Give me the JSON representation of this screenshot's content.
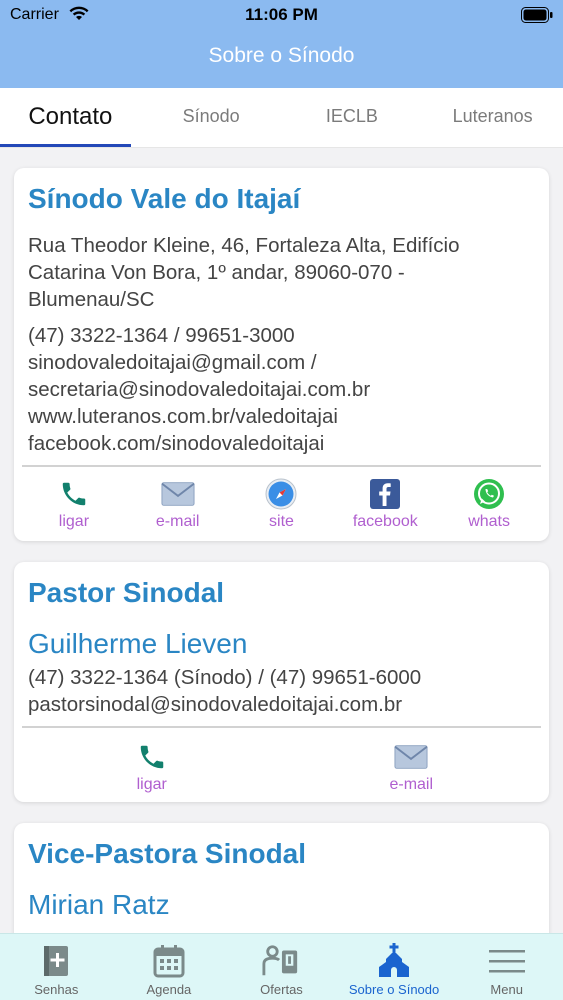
{
  "status_bar": {
    "carrier": "Carrier",
    "time": "11:06 PM"
  },
  "header": {
    "title": "Sobre o Sínodo"
  },
  "tabs": [
    {
      "label": "Contato",
      "active": true
    },
    {
      "label": "Sínodo",
      "active": false
    },
    {
      "label": "IECLB",
      "active": false
    },
    {
      "label": "Luteranos",
      "active": false
    }
  ],
  "cards": [
    {
      "title": "Sínodo Vale do Itajaí",
      "address_lines": [
        "Rua Theodor Kleine, 46, Fortaleza Alta, Edifício",
        "Catarina Von Bora, 1º andar, 89060-070 -",
        "Blumenau/SC"
      ],
      "contact_lines": [
        "(47) 3322-1364 / 99651-3000",
        "sinodovaledoitajai@gmail.com /",
        "secretaria@sinodovaledoitajai.com.br",
        "www.luteranos.com.br/valedoitajai",
        "facebook.com/sinodovaledoitajai"
      ],
      "actions": [
        {
          "label": "ligar",
          "icon": "phone-icon"
        },
        {
          "label": "e-mail",
          "icon": "mail-icon"
        },
        {
          "label": "site",
          "icon": "compass-icon"
        },
        {
          "label": "facebook",
          "icon": "facebook-icon"
        },
        {
          "label": "whats",
          "icon": "whatsapp-icon"
        }
      ]
    },
    {
      "title": "Pastor Sinodal",
      "person": "Guilherme Lieven",
      "contact_lines": [
        "(47) 3322-1364 (Sínodo) / (47) 99651-6000",
        "pastorsinodal@sinodovaledoitajai.com.br"
      ],
      "actions": [
        {
          "label": "ligar",
          "icon": "phone-icon"
        },
        {
          "label": "e-mail",
          "icon": "mail-icon"
        }
      ]
    },
    {
      "title": "Vice-Pastora Sinodal",
      "person": "Mirian Ratz"
    }
  ],
  "tabbar": [
    {
      "label": "Senhas",
      "icon": "bible-add-icon",
      "active": false
    },
    {
      "label": "Agenda",
      "icon": "calendar-icon",
      "active": false
    },
    {
      "label": "Ofertas",
      "icon": "offering-icon",
      "active": false
    },
    {
      "label": "Sobre o Sínodo",
      "icon": "church-icon",
      "active": true
    },
    {
      "label": "Menu",
      "icon": "menu-icon",
      "active": false
    }
  ],
  "colors": {
    "header": "#8bbaf0",
    "title_blue": "#2a86c4",
    "action_label": "#b05fcf",
    "phone_green": "#12806d",
    "tab_active_blue": "#1a64cf",
    "tabbar_bg": "#ddf7f7"
  }
}
